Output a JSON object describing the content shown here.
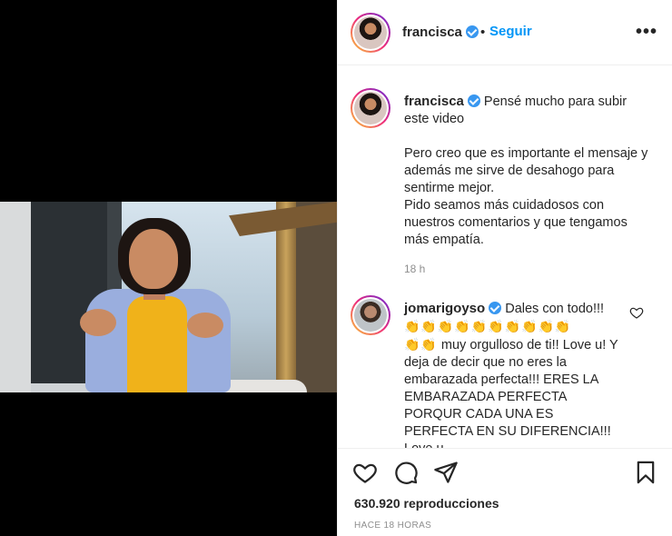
{
  "header": {
    "username": "francisca",
    "separator": "•",
    "follow_label": "Seguir",
    "more_label": "•••"
  },
  "caption": {
    "username": "francisca",
    "text_first": "Pensé mucho para subir este video",
    "text_body": "Pero creo que es importante el mensaje y además me sirve de desahogo para sentirme mejor.",
    "text_body2": "Pido seamos más cuidadosos con nuestros comentarios y que tengamos más empatía.",
    "time": "18 h"
  },
  "comment": {
    "username": "jomarigoyso",
    "text_first": "Dales con todo!!!",
    "claps_row1": "👏👏👏👏👏👏👏👏👏👏",
    "claps_row2": "👏👏",
    "text_rest1": "muy orgulloso de ti!! Love u! Y deja de decir que no eres la embarazada perfecta!!!",
    "text_rest2": "ERES LA EMBARAZADA PERFECTA PORQUR CADA UNA ES PERFECTA EN SU DIFERENCIA!!! Love u"
  },
  "footer": {
    "views": "630.920 reproducciones",
    "posted": "HACE 18 HORAS"
  },
  "icons": {
    "like": "heart-icon",
    "comment": "comment-icon",
    "share": "paper-plane-icon",
    "save": "bookmark-icon",
    "verified": "verified-badge-icon"
  },
  "colors": {
    "link_blue": "#0095f6",
    "verified_blue": "#3897f0",
    "muted": "#8e8e8e"
  }
}
